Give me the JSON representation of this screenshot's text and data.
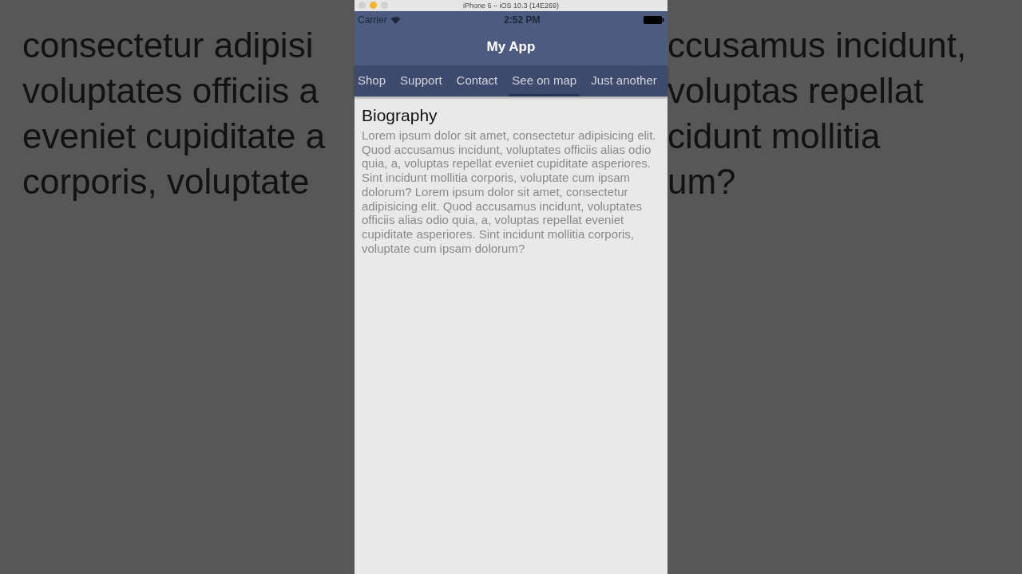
{
  "backdrop": {
    "left_lines": [
      "consectetur adipisi",
      "voluptates officiis a",
      "eveniet cupiditate a",
      "corporis, voluptate"
    ],
    "right_lines": [
      "ccusamus incidunt,",
      "voluptas repellat",
      "cidunt mollitia",
      "um?"
    ]
  },
  "window": {
    "title": "iPhone 6 – iOS 10.3 (14E269)"
  },
  "status_bar": {
    "carrier": "Carrier",
    "time": "2:52 PM"
  },
  "nav_bar": {
    "title": "My App"
  },
  "tabs": [
    {
      "label": "Shop",
      "selected": false
    },
    {
      "label": "Support",
      "selected": false
    },
    {
      "label": "Contact",
      "selected": false
    },
    {
      "label": "See on map",
      "selected": true
    },
    {
      "label": "Just another",
      "selected": false
    }
  ],
  "content": {
    "heading": "Biography",
    "body": "Lorem ipsum dolor sit amet, consectetur adipisicing elit. Quod accusamus incidunt, voluptates officiis alias odio quia, a, voluptas repellat eveniet cupiditate asperiores. Sint incidunt mollitia corporis, voluptate cum ipsam dolorum? Lorem ipsum dolor sit amet, consectetur adipisicing elit. Quod accusamus incidunt, voluptates officiis alias odio quia, a, voluptas repellat eveniet cupiditate asperiores. Sint incidunt mollitia corporis, voluptate cum ipsam dolorum?"
  }
}
